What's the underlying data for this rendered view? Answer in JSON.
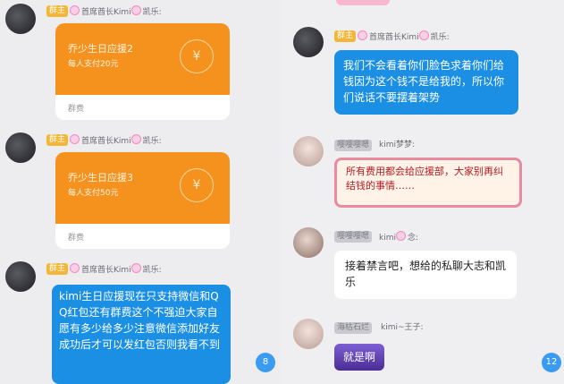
{
  "left": {
    "items": [
      {
        "badge": "群主",
        "name": "首席酋长Kimi",
        "suffix": "凯乐:"
      },
      {
        "badge": "群主",
        "name": "首席酋长Kimi",
        "suffix": "凯乐:"
      },
      {
        "badge": "群主",
        "name": "首席酋长Kimi",
        "suffix": "凯乐:"
      }
    ],
    "packets": [
      {
        "title": "乔少生日应援2",
        "amount": "每人支付20元",
        "footer": "群费",
        "coin": "¥"
      },
      {
        "title": "乔少生日应援3",
        "amount": "每人支付50元",
        "footer": "群费",
        "coin": "¥"
      }
    ],
    "message": "kimi生日应援现在只支持微信和QQ红包还有群费这个不强迫大家自愿有多少给多少注意微信添加好友成功后才可以发红包否则我看不到",
    "unread": "8"
  },
  "right": {
    "messages": [
      {
        "badge": "群主",
        "name": "首席酋长Kimi",
        "suffix": "凯乐:",
        "text": "我们不会看着你们脸色求着你们给钱因为这个钱不是给我的，所以你们说话不要摆着架势"
      },
      {
        "badge": "嘤嘤嘤嗯",
        "name": "kimi梦梦:",
        "text": "所有费用都会给应援部，大家别再纠结钱的事情……"
      },
      {
        "badge": "嘤嘤嘤嗯",
        "name": "kimi",
        "suffix": "念:",
        "text": "接着禁言吧，想给的私聊大志和凯乐"
      },
      {
        "badge": "海枯石烂",
        "name": "kimi~王子:",
        "text": "就是啊"
      }
    ],
    "unread": "12"
  },
  "colors": {
    "orange": "#f5921e",
    "blue": "#1b8fe3",
    "gold_badge": "#f2b739",
    "background": "#eeeef0"
  }
}
